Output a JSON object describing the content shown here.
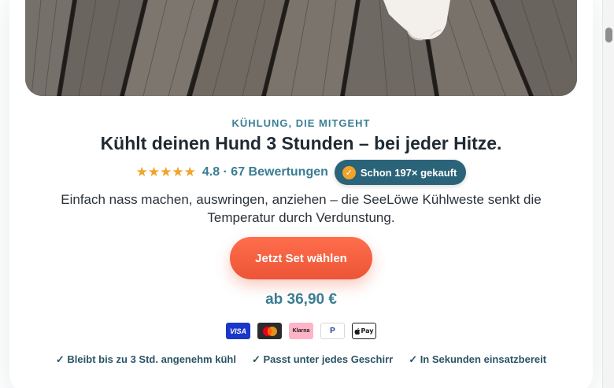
{
  "hero": {
    "image_description": "dog-paw-on-wooden-boards"
  },
  "eyebrow": "KÜHLUNG, DIE MITGEHT",
  "headline": "Kühlt deinen Hund 3 Stunden – bei jeder Hitze.",
  "rating": {
    "stars": "★★★★★",
    "value": 4.8,
    "text": "4.8 · 67 Bewertungen"
  },
  "sold_badge": {
    "icon": "check-icon",
    "check_glyph": "✓",
    "text": "Schon 197× gekauft"
  },
  "description": "Einfach nass machen, auswringen, anziehen – die SeeLöwe Kühlweste senkt die Temperatur durch Verdunstung.",
  "cta": {
    "label": "Jetzt Set wählen"
  },
  "price": "ab 36,90 €",
  "payments": [
    {
      "name": "visa",
      "label": "VISA"
    },
    {
      "name": "mastercard",
      "label": ""
    },
    {
      "name": "klarna",
      "label": "Klarna"
    },
    {
      "name": "paypal",
      "label": "P"
    },
    {
      "name": "apple-pay",
      "label": "Pay"
    }
  ],
  "benefits": [
    "✓ Bleibt bis zu 3 Std. angenehm kühl",
    "✓ Passt unter jedes Geschirr",
    "✓ In Sekunden einsatzbereit"
  ],
  "colors": {
    "accent_teal": "#3a7d93",
    "badge_bg": "#2b6478",
    "star": "#f2a32c",
    "cta_orange": "#ec5535"
  }
}
